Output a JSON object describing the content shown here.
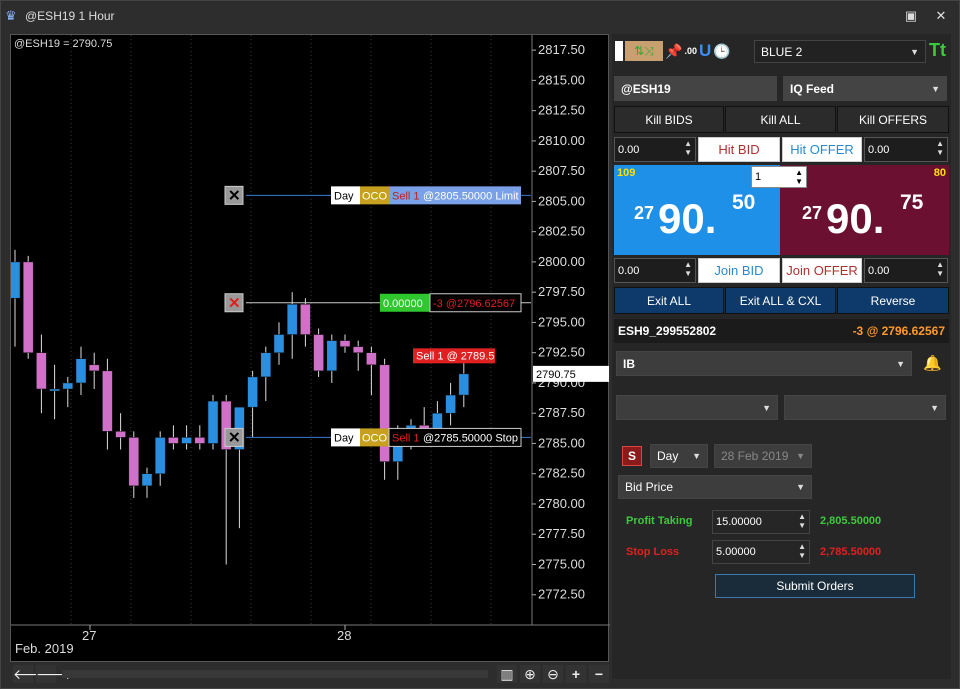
{
  "window": {
    "title": "@ESH19 1 Hour"
  },
  "chart": {
    "symbol_readout": "@ESH19 = 2790.75",
    "price_labels": [
      "2817.50",
      "2815.00",
      "2812.50",
      "2810.00",
      "2807.50",
      "2805.00",
      "2802.50",
      "2800.00",
      "2797.50",
      "2795.00",
      "2792.50",
      "2790.00",
      "2787.50",
      "2785.00",
      "2782.50",
      "2780.00",
      "2777.50",
      "2775.00",
      "2772.50"
    ],
    "current_price": "2790.75",
    "date_labels": [
      "27",
      "28"
    ],
    "month_label": "Feb. 2019",
    "orders": [
      {
        "tif": "Day",
        "type": "OCO",
        "side": "Sell 1",
        "detail": "@2805.50000 Limit"
      },
      {
        "tif": "Day",
        "type": "OCO",
        "side": "Sell 1",
        "detail": "@2785.50000 Stop"
      }
    ],
    "position_line": {
      "pnl": "0.00000",
      "detail": "-3 @2796.62567"
    },
    "fill_marker": "Sell 1 @ 2789.5",
    "candles": [
      {
        "o": 2797.0,
        "h": 2801.0,
        "l": 2793.0,
        "c": 2800.0
      },
      {
        "o": 2800.0,
        "h": 2800.5,
        "l": 2792.0,
        "c": 2792.5
      },
      {
        "o": 2792.5,
        "h": 2794.0,
        "l": 2787.5,
        "c": 2789.5
      },
      {
        "o": 2789.5,
        "h": 2791.5,
        "l": 2787.0,
        "c": 2789.5
      },
      {
        "o": 2789.5,
        "h": 2790.5,
        "l": 2788.0,
        "c": 2790.0
      },
      {
        "o": 2790.0,
        "h": 2793.0,
        "l": 2789.0,
        "c": 2792.0
      },
      {
        "o": 2791.5,
        "h": 2792.5,
        "l": 2789.5,
        "c": 2791.0
      },
      {
        "o": 2791.0,
        "h": 2792.0,
        "l": 2784.5,
        "c": 2786.0
      },
      {
        "o": 2786.0,
        "h": 2787.5,
        "l": 2784.5,
        "c": 2785.5
      },
      {
        "o": 2785.5,
        "h": 2786.0,
        "l": 2780.5,
        "c": 2781.5
      },
      {
        "o": 2781.5,
        "h": 2783.0,
        "l": 2780.5,
        "c": 2782.5
      },
      {
        "o": 2782.5,
        "h": 2786.0,
        "l": 2781.5,
        "c": 2785.5
      },
      {
        "o": 2785.5,
        "h": 2786.5,
        "l": 2784.5,
        "c": 2785.0
      },
      {
        "o": 2785.0,
        "h": 2786.5,
        "l": 2784.5,
        "c": 2785.5
      },
      {
        "o": 2785.5,
        "h": 2786.5,
        "l": 2784.5,
        "c": 2785.0
      },
      {
        "o": 2785.0,
        "h": 2789.0,
        "l": 2784.5,
        "c": 2788.5
      },
      {
        "o": 2788.5,
        "h": 2789.0,
        "l": 2775.0,
        "c": 2784.5
      },
      {
        "o": 2784.5,
        "h": 2788.0,
        "l": 2778.0,
        "c": 2788.0
      },
      {
        "o": 2788.0,
        "h": 2791.0,
        "l": 2785.5,
        "c": 2790.5
      },
      {
        "o": 2790.5,
        "h": 2793.0,
        "l": 2788.5,
        "c": 2792.5
      },
      {
        "o": 2792.5,
        "h": 2795.0,
        "l": 2791.5,
        "c": 2794.0
      },
      {
        "o": 2794.0,
        "h": 2797.5,
        "l": 2792.0,
        "c": 2796.5
      },
      {
        "o": 2796.5,
        "h": 2797.0,
        "l": 2793.0,
        "c": 2794.0
      },
      {
        "o": 2794.0,
        "h": 2794.5,
        "l": 2790.5,
        "c": 2791.0
      },
      {
        "o": 2791.0,
        "h": 2794.0,
        "l": 2790.0,
        "c": 2793.5
      },
      {
        "o": 2793.5,
        "h": 2794.0,
        "l": 2792.5,
        "c": 2793.0
      },
      {
        "o": 2793.0,
        "h": 2793.5,
        "l": 2791.0,
        "c": 2792.5
      },
      {
        "o": 2792.5,
        "h": 2793.0,
        "l": 2789.0,
        "c": 2791.5
      },
      {
        "o": 2791.5,
        "h": 2792.0,
        "l": 2782.0,
        "c": 2783.5
      },
      {
        "o": 2783.5,
        "h": 2786.5,
        "l": 2782.0,
        "c": 2785.0
      },
      {
        "o": 2785.0,
        "h": 2787.0,
        "l": 2784.5,
        "c": 2786.5
      },
      {
        "o": 2786.5,
        "h": 2788.0,
        "l": 2785.5,
        "c": 2786.0
      },
      {
        "o": 2786.0,
        "h": 2788.5,
        "l": 2785.5,
        "c": 2787.5
      },
      {
        "o": 2787.5,
        "h": 2790.0,
        "l": 2786.5,
        "c": 2789.0
      },
      {
        "o": 2789.0,
        "h": 2792.5,
        "l": 2788.0,
        "c": 2790.75
      }
    ],
    "colors": {
      "up": "#2a8fe0",
      "down": "#d070c8",
      "grid": "#3a3a3a"
    }
  },
  "panel": {
    "color_scheme": "BLUE 2",
    "symbol": "@ESH19",
    "feed": "IQ Feed",
    "kill_bids": "Kill BIDS",
    "kill_all": "Kill ALL",
    "kill_offers": "Kill OFFERS",
    "hit_bid_qty": "0.00",
    "hit_bid": "Hit BID",
    "hit_offer": "Hit OFFER",
    "hit_offer_qty": "0.00",
    "bid_size": "109",
    "ask_size": "80",
    "order_qty": "1",
    "bid_prefix": "27",
    "bid_main": "90.",
    "bid_frac": "50",
    "ask_prefix": "27",
    "ask_main": "90.",
    "ask_frac": "75",
    "join_bid_qty": "0.00",
    "join_bid": "Join BID",
    "join_offer": "Join OFFER",
    "join_offer_qty": "0.00",
    "exit_all": "Exit ALL",
    "exit_all_cxl": "Exit ALL & CXL",
    "reverse": "Reverse",
    "account": "ESH9_299552802",
    "position": "-3 @ 2796.62567",
    "broker": "IB",
    "tif": "Day",
    "date": "28 Feb 2019",
    "s_label": "S",
    "price_type": "Bid Price",
    "profit_taking_label": "Profit Taking",
    "profit_taking_value": "15.00000",
    "profit_taking_price": "2,805.50000",
    "stop_loss_label": "Stop Loss",
    "stop_loss_value": "5.00000",
    "stop_loss_price": "2,785.50000",
    "submit": "Submit Orders",
    "colors": {
      "bid_bg": "#1e90e8",
      "ask_bg": "#6b1030",
      "green": "#3ec83e",
      "red": "#e02020",
      "orange": "#ff9a2a"
    }
  }
}
